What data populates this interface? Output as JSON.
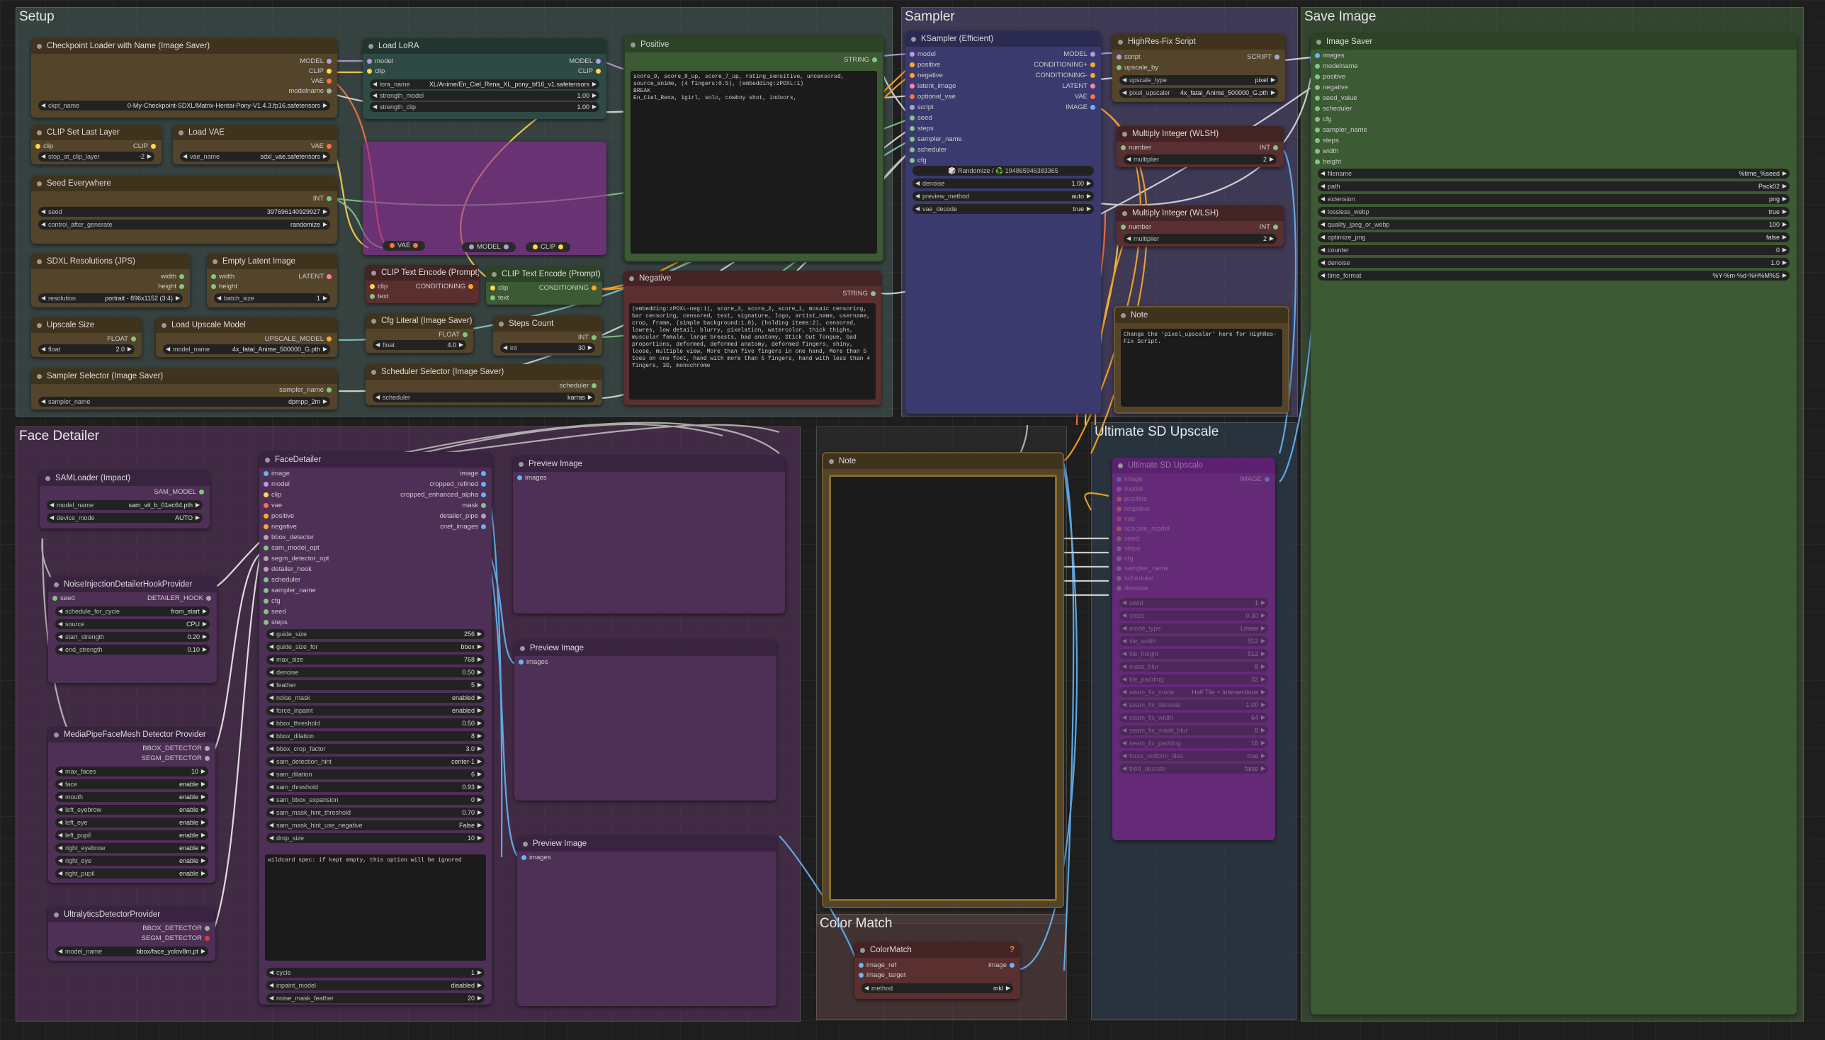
{
  "groups": {
    "setup": "Setup",
    "sampler": "Sampler",
    "save_image": "Save Image",
    "face_detailer": "Face Detailer",
    "ultimate_sd_upscale": "Ultimate SD Upscale",
    "color_match": "Color Match"
  },
  "nodes": {
    "ckpt": {
      "title": "Checkpoint Loader with Name (Image Saver)",
      "outputs": [
        "MODEL",
        "CLIP",
        "VAE",
        "modelname"
      ],
      "w_label": "ckpt_name",
      "w_value": "0-My-Checkpoint-SDXL/Matrix-Hentai-Pony-V1.4.3.fp16.safetensors"
    },
    "lora": {
      "title": "Load LoRA",
      "inputs": [
        "model",
        "clip"
      ],
      "outputs": [
        "MODEL",
        "CLIP"
      ],
      "widgets": [
        [
          "lora_name",
          "XL/Anime/En_Ciel_Rena_XL_pony_bf16_v1.safetensors"
        ],
        [
          "strength_model",
          "1.00"
        ],
        [
          "strength_clip",
          "1.00"
        ]
      ]
    },
    "positive": {
      "title": "Positive",
      "output": "STRING",
      "text": "score_9, score_8_up, score_7_up, rating_sensitive, uncensored, source_anime, (4 fingers:0.5), (embedding:zPDXL:1)\nBREAK\nEn_Ciel_Rena, 1girl, solo, cowboy shot, indoors,"
    },
    "clip_skip": {
      "title": "CLIP Set Last Layer",
      "input": "clip",
      "output": "CLIP",
      "w_label": "stop_at_clip_layer",
      "w_value": "-2"
    },
    "vae": {
      "title": "Load VAE",
      "output": "VAE",
      "w_label": "vae_name",
      "w_value": "sdxl_vae.safetensors"
    },
    "seed": {
      "title": "Seed Everywhere",
      "output": "INT",
      "widgets": [
        [
          "seed",
          "397696140929927"
        ],
        [
          "control_after_generate",
          "randomize"
        ]
      ]
    },
    "sdxl_res": {
      "title": "SDXL Resolutions (JPS)",
      "outputs": [
        "width",
        "height"
      ],
      "w_label": "resolution",
      "w_value": "portrait - 896x1152 (3:4)"
    },
    "empty_latent": {
      "title": "Empty Latent Image",
      "inputs": [
        "width",
        "height"
      ],
      "output": "LATENT",
      "w_label": "batch_size",
      "w_value": "1"
    },
    "clip_enc1": {
      "title": "CLIP Text Encode (Prompt)",
      "inputs": [
        "clip",
        "text"
      ],
      "output": "CONDITIONING"
    },
    "clip_enc2": {
      "title": "CLIP Text Encode (Prompt)",
      "inputs": [
        "clip",
        "text"
      ],
      "output": "CONDITIONING"
    },
    "negative": {
      "title": "Negative",
      "output": "STRING",
      "text": "(embedding:zPDXL-neg:1), score_3, score_2, score_1, mosaic censoring, bar censoring, censored, text, signature, logo, artist_name, username, crop, frame, (simple background:1.0), (holding items:2), censored, lowres, low detail, blurry, pixelation, watercolor, thick thighs, muscular female, large breasts, bad anatomy, Stick Out Tongue, bad proportions, deformed, deformed anatomy, deformed fingers, shiny, loose, multiple view, More than five fingers in one hand, More than 5 toes on one foot, hand with more than 5 fingers, hand with less than 4 fingers, 3D, monochrome"
    },
    "upscale_size": {
      "title": "Upscale Size",
      "output": "FLOAT",
      "w_label": "float",
      "w_value": "2.0"
    },
    "load_upscale": {
      "title": "Load Upscale Model",
      "output": "UPSCALE_MODEL",
      "w_label": "model_name",
      "w_value": "4x_fatal_Anime_500000_G.pth"
    },
    "cfg_literal": {
      "title": "Cfg Literal (Image Saver)",
      "output": "FLOAT",
      "w_label": "float",
      "w_value": "4.0"
    },
    "steps_count": {
      "title": "Steps Count",
      "output": "INT",
      "w_label": "int",
      "w_value": "30"
    },
    "sampler_sel": {
      "title": "Sampler Selector (Image Saver)",
      "output": "sampler_name",
      "w_label": "sampler_name",
      "w_value": "dpmpp_2m"
    },
    "sched_sel": {
      "title": "Scheduler Selector (Image Saver)",
      "output": "scheduler",
      "w_label": "scheduler",
      "w_value": "karras"
    },
    "reroutes": {
      "vae": "VAE",
      "model": "MODEL",
      "clip": "CLIP"
    },
    "ksampler": {
      "title": "KSampler (Efficient)",
      "inputs": [
        "model",
        "positive",
        "negative",
        "latent_image",
        "optional_vae",
        "script",
        "seed",
        "steps",
        "sampler_name",
        "scheduler",
        "cfg"
      ],
      "outputs": [
        "MODEL",
        "CONDITIONING+",
        "CONDITIONING-",
        "LATENT",
        "VAE",
        "IMAGE"
      ],
      "seed_btn": "🎲 Randomize / ♻️ 194865946383365",
      "widgets": [
        [
          "denoise",
          "1.00"
        ],
        [
          "preview_method",
          "auto"
        ],
        [
          "vae_decode",
          "true"
        ]
      ]
    },
    "hires": {
      "title": "HighRes-Fix Script",
      "inputs": [
        "script",
        "upscale_by"
      ],
      "output": "SCRIPT",
      "widgets": [
        [
          "upscale_type",
          "pixel"
        ],
        [
          "pixel_upscaler",
          "4x_fatal_Anime_500000_G.pth"
        ]
      ]
    },
    "mult1": {
      "title": "Multiply Integer (WLSH)",
      "input": "number",
      "output": "INT",
      "w_label": "multiplier",
      "w_value": "2"
    },
    "mult2": {
      "title": "Multiply Integer (WLSH)",
      "input": "number",
      "output": "INT",
      "w_label": "multiplier",
      "w_value": "2"
    },
    "note_small": {
      "title": "Note",
      "text": "Change the 'pixel_upscaler' here for HighRes-Fix Script."
    },
    "image_saver": {
      "title": "Image Saver",
      "inputs": [
        "images",
        "modelname",
        "positive",
        "negative",
        "seed_value",
        "scheduler",
        "cfg",
        "sampler_name",
        "steps",
        "width",
        "height"
      ],
      "widgets": [
        [
          "filename",
          "%time_%seed"
        ],
        [
          "path",
          "Pack02"
        ],
        [
          "extension",
          "png"
        ],
        [
          "lossless_webp",
          "true"
        ],
        [
          "quality_jpeg_or_webp",
          "100"
        ],
        [
          "optimize_png",
          "false"
        ],
        [
          "counter",
          "0"
        ],
        [
          "denoise",
          "1.0"
        ],
        [
          "time_format",
          "%Y-%m-%d-%H%M%S"
        ]
      ]
    },
    "samloader": {
      "title": "SAMLoader (Impact)",
      "output": "SAM_MODEL",
      "widgets": [
        [
          "model_name",
          "sam_vit_b_01ec64.pth"
        ],
        [
          "device_mode",
          "AUTO"
        ]
      ]
    },
    "noise_inj": {
      "title": "NoiseInjectionDetailerHookProvider",
      "input": "seed",
      "output": "DETAILER_HOOK",
      "widgets": [
        [
          "schedule_for_cycle",
          "from_start"
        ],
        [
          "source",
          "CPU"
        ],
        [
          "start_strength",
          "0.20"
        ],
        [
          "end_strength",
          "0.10"
        ]
      ]
    },
    "mediapipe": {
      "title": "MediaPipeFaceMesh Detector Provider",
      "outputs": [
        "BBOX_DETECTOR",
        "SEGM_DETECTOR"
      ],
      "widgets": [
        [
          "max_faces",
          "10"
        ],
        [
          "face",
          "enable"
        ],
        [
          "mouth",
          "enable"
        ],
        [
          "left_eyebrow",
          "enable"
        ],
        [
          "left_eye",
          "enable"
        ],
        [
          "left_pupil",
          "enable"
        ],
        [
          "right_eyebrow",
          "enable"
        ],
        [
          "right_eye",
          "enable"
        ],
        [
          "right_pupil",
          "enable"
        ]
      ]
    },
    "ultralytics": {
      "title": "UltralyticsDetectorProvider",
      "outputs": [
        "BBOX_DETECTOR",
        "SEGM_DETECTOR"
      ],
      "w_label": "model_name",
      "w_value": "bbox/face_yolov8m.pt"
    },
    "facedetailer": {
      "title": "FaceDetailer",
      "inputs": [
        "image",
        "model",
        "clip",
        "vae",
        "positive",
        "negative",
        "bbox_detector",
        "sam_model_opt",
        "segm_detector_opt",
        "detailer_hook",
        "scheduler",
        "sampler_name",
        "cfg",
        "seed",
        "steps"
      ],
      "outputs": [
        "image",
        "cropped_refined",
        "cropped_enhanced_alpha",
        "mask",
        "detailer_pipe",
        "cnet_images"
      ],
      "widgets": [
        [
          "guide_size",
          "256"
        ],
        [
          "guide_size_for",
          "bbox"
        ],
        [
          "max_size",
          "768"
        ],
        [
          "denoise",
          "0.50"
        ],
        [
          "feather",
          "5"
        ],
        [
          "noise_mask",
          "enabled"
        ],
        [
          "force_inpaint",
          "enabled"
        ],
        [
          "bbox_threshold",
          "0.50"
        ],
        [
          "bbox_dilation",
          "8"
        ],
        [
          "bbox_crop_factor",
          "3.0"
        ],
        [
          "sam_detection_hint",
          "center-1"
        ],
        [
          "sam_dilation",
          "6"
        ],
        [
          "sam_threshold",
          "0.93"
        ],
        [
          "sam_bbox_expansion",
          "0"
        ],
        [
          "sam_mask_hint_threshold",
          "0.70"
        ],
        [
          "sam_mask_hint_use_negative",
          "False"
        ],
        [
          "drop_size",
          "10"
        ]
      ],
      "wildcard": "wildcard spec: if kept empty, this option will be ignored",
      "bottom": [
        [
          "cycle",
          "1"
        ],
        [
          "inpaint_model",
          "disabled"
        ],
        [
          "noise_mask_feather",
          "20"
        ]
      ]
    },
    "preview1": {
      "title": "Preview Image",
      "input": "images"
    },
    "preview2": {
      "title": "Preview Image",
      "input": "images"
    },
    "preview3": {
      "title": "Preview Image",
      "input": "images"
    },
    "note_big": {
      "title": "Note"
    },
    "usd_upscale": {
      "title": "Ultimate SD Upscale",
      "output": "IMAGE",
      "inputs": [
        "image",
        "model",
        "positive",
        "negative",
        "vae",
        "upscale_model",
        "seed",
        "steps",
        "cfg",
        "sampler_name",
        "scheduler",
        "denoise"
      ],
      "widgets": [
        [
          "seed",
          "1"
        ],
        [
          "steps",
          "0.30"
        ],
        [
          "mode_type",
          "Linear"
        ],
        [
          "tile_width",
          "512"
        ],
        [
          "tile_height",
          "512"
        ],
        [
          "mask_blur",
          "8"
        ],
        [
          "tile_padding",
          "32"
        ],
        [
          "seam_fix_mode",
          "Half Tile + Intersections"
        ],
        [
          "seam_fix_denoise",
          "1.00"
        ],
        [
          "seam_fix_width",
          "64"
        ],
        [
          "seam_fix_mask_blur",
          "8"
        ],
        [
          "seam_fix_padding",
          "16"
        ],
        [
          "force_uniform_tiles",
          "true"
        ],
        [
          "tiled_decode",
          "false"
        ]
      ]
    },
    "colormatch": {
      "title": "ColorMatch",
      "inputs": [
        "image_ref",
        "image_target"
      ],
      "output": "image",
      "w_label": "method",
      "w_value": "mkl",
      "badge": "?"
    }
  },
  "colors": {
    "group_setup": "#3d4a48",
    "group_sampler": "#433d5e",
    "group_save": "#3b4f35",
    "group_face": "#4a2c4f",
    "group_upscale": "#2f3f4d",
    "group_colormatch": "#4f3a3a",
    "node_brown": "#54452a",
    "node_brown_head": "#3f331d",
    "node_purple": "#4e2f55",
    "node_purple_head": "#3a2340",
    "node_green": "#3c5a33",
    "node_green_head": "#2c4326",
    "node_blue": "#3a3a6e",
    "node_blue_head": "#2b2b52",
    "node_teal": "#2f4a45",
    "node_teal_head": "#22362f",
    "node_red": "#5a2f2f",
    "node_red_head": "#432323"
  }
}
